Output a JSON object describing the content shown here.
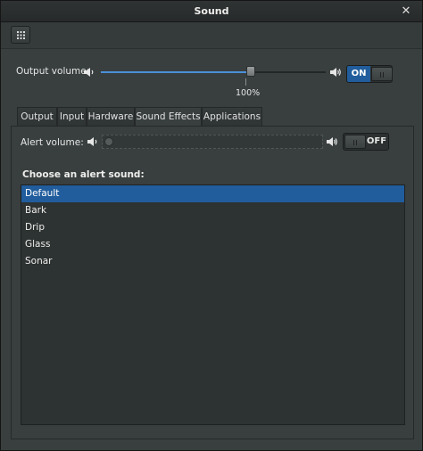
{
  "window": {
    "title": "Sound",
    "close_glyph": "✕"
  },
  "toolbar": {
    "menu_icon": "grid-icon"
  },
  "output_volume": {
    "label": "Output volume:",
    "value_label": "100%",
    "level_percent": 100,
    "switch_label": "ON",
    "switch_on": true
  },
  "tabs": [
    {
      "label": "Output",
      "active": false
    },
    {
      "label": "Input",
      "active": false
    },
    {
      "label": "Hardware",
      "active": false
    },
    {
      "label": "Sound Effects",
      "active": true
    },
    {
      "label": "Applications",
      "active": false
    }
  ],
  "sound_effects": {
    "alert_volume_label": "Alert volume:",
    "alert_level_percent": 0,
    "switch_label": "OFF",
    "switch_on": false,
    "alert_heading": "Choose an alert sound:",
    "sounds": [
      {
        "label": "Default",
        "selected": true
      },
      {
        "label": "Bark",
        "selected": false
      },
      {
        "label": "Drip",
        "selected": false
      },
      {
        "label": "Glass",
        "selected": false
      },
      {
        "label": "Sonar",
        "selected": false
      }
    ]
  },
  "colors": {
    "accent": "#215d9c",
    "slider_fill": "#4a90d9",
    "background": "#393f3f"
  }
}
